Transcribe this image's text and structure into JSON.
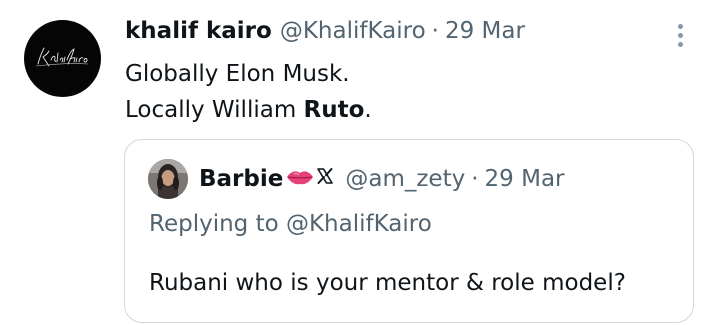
{
  "tweet": {
    "author_name": "khalif kairo",
    "handle": "@KhalifKairo",
    "separator": "·",
    "date": "29 Mar",
    "avatar_text": "Khalif Kairo",
    "text_line1": "Globally Elon Musk.",
    "text_line2_prefix": "Locally William ",
    "text_line2_bold": "Ruto",
    "text_line2_suffix": ".",
    "more_icon": "more-vertical-icon"
  },
  "quote": {
    "author_name": "Barbie",
    "name_emoji": "lips-icon",
    "platform_icon": "x-logo-icon",
    "handle": "@am_zety",
    "separator": "·",
    "date": "29 Mar",
    "replying_to": "Replying to @KhalifKairo",
    "text": "Rubani who is your mentor & role model?"
  },
  "colors": {
    "text_primary": "#0f1419",
    "text_secondary": "#536471",
    "border": "#cfd9de",
    "lips": "#e8417a"
  }
}
